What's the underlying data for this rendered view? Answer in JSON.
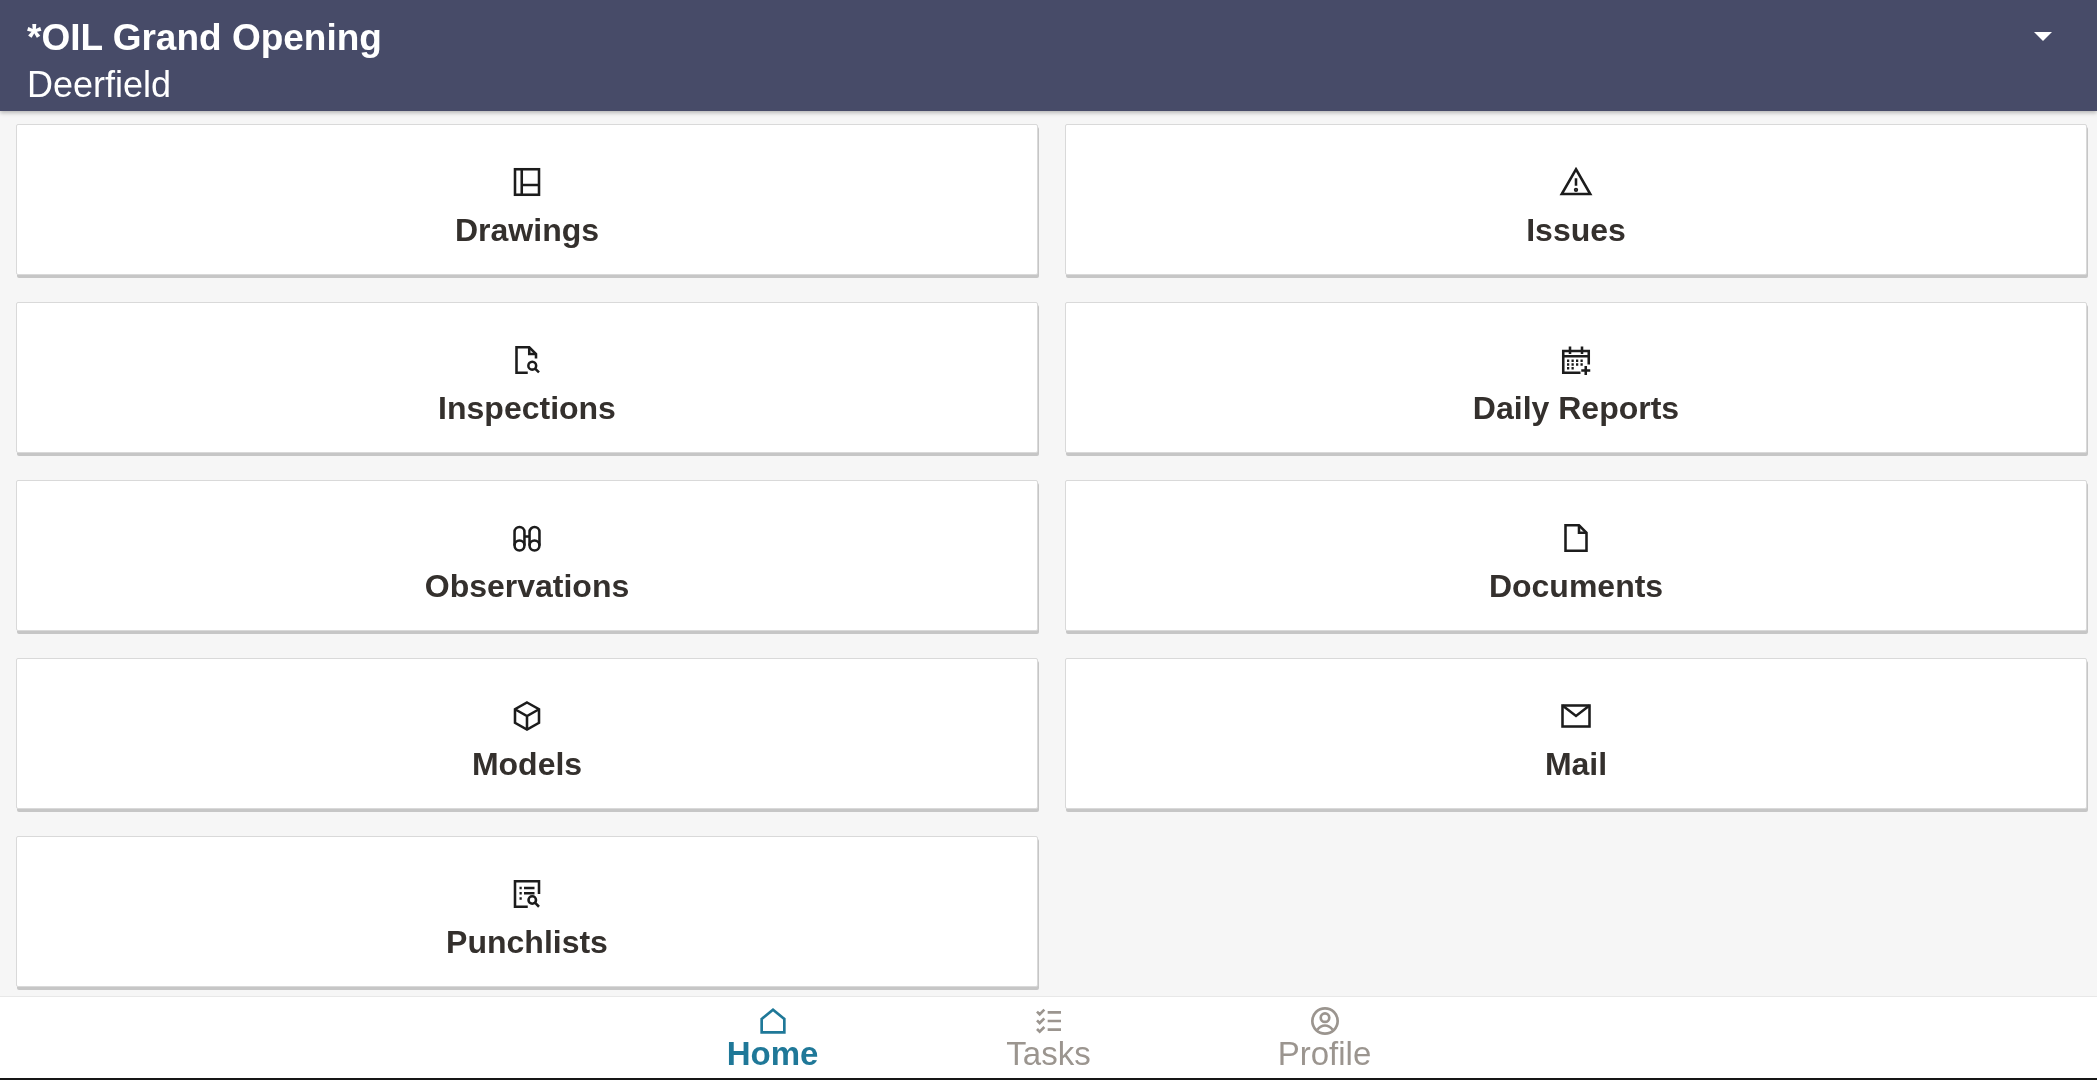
{
  "header": {
    "title": "*OIL Grand Opening",
    "subtitle": "Deerfield"
  },
  "tiles": [
    {
      "label": "Drawings"
    },
    {
      "label": "Issues"
    },
    {
      "label": "Inspections"
    },
    {
      "label": "Daily Reports"
    },
    {
      "label": "Observations"
    },
    {
      "label": "Documents"
    },
    {
      "label": "Models"
    },
    {
      "label": "Mail"
    },
    {
      "label": "Punchlists"
    }
  ],
  "tabs": [
    {
      "label": "Home",
      "selected": true
    },
    {
      "label": "Tasks",
      "selected": false
    },
    {
      "label": "Profile",
      "selected": false
    }
  ]
}
